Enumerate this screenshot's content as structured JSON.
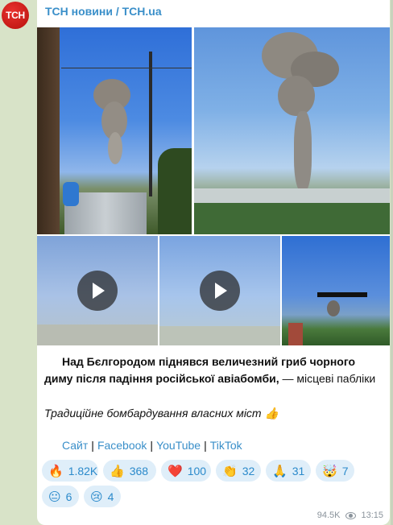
{
  "channel": {
    "avatar_text": "TCH",
    "name": "ТСН новини / TCH.ua"
  },
  "post": {
    "line1": "Над Бєлгородом піднявся величезний гриб чорного диму після падіння російської авіабомби,",
    "line1_rest": " — місцеві пабліки",
    "line2": "Традиційне бомбардування власних міст 👍",
    "links": [
      "Сайт",
      "Facebook",
      "YouTube",
      "TikTok"
    ]
  },
  "reactions": [
    {
      "emoji": "🔥",
      "count": "1.82K"
    },
    {
      "emoji": "👍",
      "count": "368"
    },
    {
      "emoji": "❤️",
      "count": "100"
    },
    {
      "emoji": "👏",
      "count": "32"
    },
    {
      "emoji": "🙏",
      "count": "31"
    },
    {
      "emoji": "🤯",
      "count": "7"
    },
    {
      "emoji": "😐",
      "count": "6"
    },
    {
      "emoji": "😢",
      "count": "4"
    }
  ],
  "footer": {
    "views": "94.5K",
    "time": "13:15"
  },
  "media": {
    "photos": [
      "photo-smoke-from-yard",
      "photo-smoke-over-city"
    ],
    "videos": [
      "video-1",
      "video-2",
      "video-3"
    ]
  }
}
